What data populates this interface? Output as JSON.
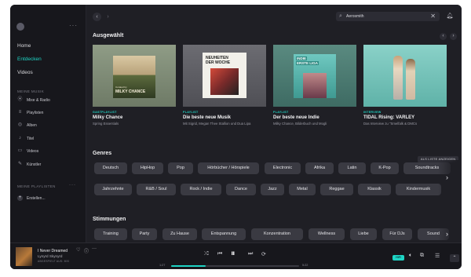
{
  "colors": {
    "accent": "#1ed5c5",
    "window_bg": "#1c1c22",
    "chip_bg": "#3a3a42"
  },
  "sidebar": {
    "more": "···",
    "nav": [
      {
        "label": "Home"
      },
      {
        "label": "Entdecken",
        "active": true
      },
      {
        "label": "Videos"
      }
    ],
    "meine_musik_label": "MEINE MUSIK",
    "library": [
      {
        "label": "Mixe & Radio",
        "icon": "radio-icon"
      },
      {
        "label": "Playlisten",
        "icon": "playlist-icon"
      },
      {
        "label": "Alben",
        "icon": "album-icon"
      },
      {
        "label": "Titel",
        "icon": "note-icon"
      },
      {
        "label": "Videos",
        "icon": "video-icon"
      },
      {
        "label": "Künstler",
        "icon": "mic-icon"
      }
    ],
    "playlists_label": "MEINE PLAYLISTEN",
    "playlists_more": "···",
    "create_label": "Erstellen..."
  },
  "topbar": {
    "back": "‹",
    "forward": "›",
    "search_value": "Aerosmith",
    "clear": "✕"
  },
  "featured": {
    "title": "Ausgewählt",
    "prev": "‹",
    "next": "›",
    "cards": [
      {
        "kind": "GASTPLAYLIST",
        "title": "Milky Chance",
        "subtitle": "Spring Essentials",
        "cover_line1": "Curated by",
        "cover_line2": "MILKY CHANCE"
      },
      {
        "kind": "PLAYLIST",
        "title": "Die beste neue Musik",
        "subtitle": "Mit Sigrid, Megan Thee Stallion und Dua Lipa",
        "cover_line1": "NEUHEITEN",
        "cover_line2": "DER WOCHE"
      },
      {
        "kind": "PLAYLIST",
        "title": "Der beste neue Indie",
        "subtitle": "Milky Chance, Bilderbuch und Mogli",
        "cover_line1": "INDIE",
        "cover_line2": "ERSTE LIGA"
      },
      {
        "kind": "INTERVIEW",
        "title": "TIDAL Rising: VARLEY",
        "subtitle": "Das Interview zu \"Smelfalk & DMCs"
      }
    ]
  },
  "genres": {
    "title": "Genres",
    "list_button": "ALS LISTE ANZEIGEN",
    "row1": [
      "Deutsch",
      "HipHop",
      "Pop",
      "Hörbücher / Hörspiele",
      "Electronic",
      "Afrika",
      "Latin",
      "K-Pop",
      "Soundtracks"
    ],
    "row2": [
      "Jahrzehnte",
      "R&B / Soul",
      "Rock / Indie",
      "Dance",
      "Jazz",
      "Metal",
      "Reggae",
      "Klassik",
      "Kindermusik"
    ],
    "arrow": "›"
  },
  "moods": {
    "title": "Stimmungen",
    "row": [
      "Training",
      "Party",
      "Zu Hause",
      "Entspannung",
      "Konzentration",
      "Wellness",
      "Liebe",
      "Für DJs",
      "Sound"
    ],
    "arrow": "›"
  },
  "player": {
    "title": "I Never Dreamed",
    "artist": "Lynyrd Skynyrd",
    "source": "ABGESPIELT AUS: MIX",
    "elapsed": "1:27",
    "duration": "5:22",
    "progress": 0.27,
    "quality": "HiFi"
  }
}
